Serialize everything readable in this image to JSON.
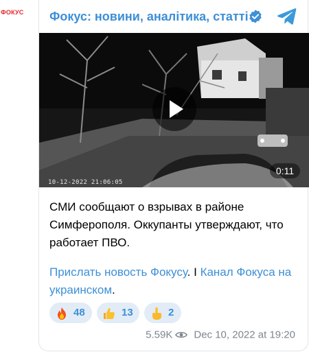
{
  "avatar": {
    "text": "ФОКУС"
  },
  "channel": {
    "title": "Фокус: новини, аналітика, статті",
    "verified_icon": "verified-check-icon",
    "share_icon": "telegram-plane-icon",
    "accent": "#3d8fd6"
  },
  "video": {
    "timestamp": "10-12-2022 21:06:05",
    "duration": "0:11"
  },
  "message": {
    "text": "СМИ сообщают о взрывах в районе Симферополя. Оккупанты утверждают, что работает ПВО."
  },
  "links": {
    "link1": "Прислать новость Фокусу",
    "separator": ". I ",
    "link2": "Канал Фокуса на украинском",
    "end": "."
  },
  "reactions": [
    {
      "icon": "fire-icon",
      "count": "48"
    },
    {
      "icon": "thumbs-up-icon",
      "count": "13"
    },
    {
      "icon": "middle-finger-icon",
      "count": "2"
    }
  ],
  "footer": {
    "views": "5.59K",
    "views_icon": "eye-icon",
    "date": "Dec 10, 2022 at 19:20"
  }
}
